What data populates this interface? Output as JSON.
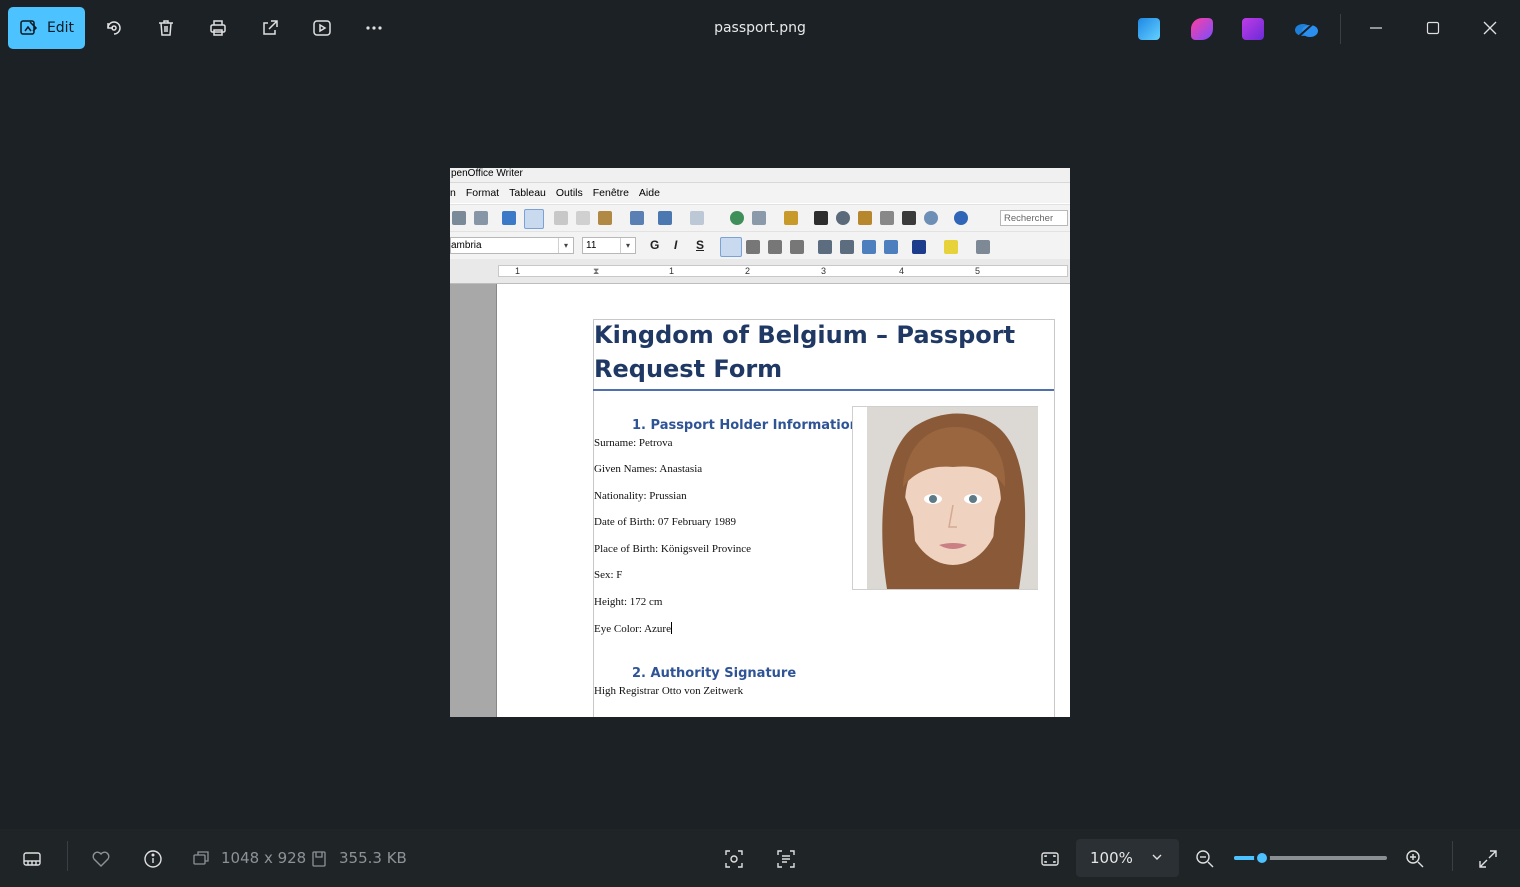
{
  "toolbar": {
    "edit_label": "Edit",
    "filename": "passport.png"
  },
  "document": {
    "app_title": "penOffice Writer",
    "menu": [
      "n",
      "Format",
      "Tableau",
      "Outils",
      "Fenêtre",
      "Aide"
    ],
    "search_placeholder": "Rechercher",
    "font_name": "ambria",
    "font_size": "11",
    "format_buttons": [
      "G",
      "I",
      "S"
    ],
    "ruler_numbers": [
      "1",
      "1",
      "2",
      "3",
      "4",
      "5"
    ],
    "title": "Kingdom of Belgium – Passport Request Form",
    "section1": "1.  Passport Holder Information",
    "fields": [
      "Surname: Petrova",
      "Given Names: Anastasia",
      "Nationality: Prussian",
      "Date of Birth: 07 February 1989",
      "Place of Birth: Königsveil Province",
      "Sex: F",
      "Height: 172 cm",
      "Eye Color: Azure"
    ],
    "section2": "2.  Authority Signature",
    "signature": "High Registrar Otto von Zeitwerk"
  },
  "statusbar": {
    "dimensions": "1048 x 928",
    "file_size": "355.3 KB",
    "zoom": "100%",
    "zoom_slider_fraction": 0.18
  },
  "colors": {
    "accent": "#4cc2ff",
    "background": "#1c2125",
    "heading": "#1f3864",
    "subheading": "#2f5496"
  }
}
